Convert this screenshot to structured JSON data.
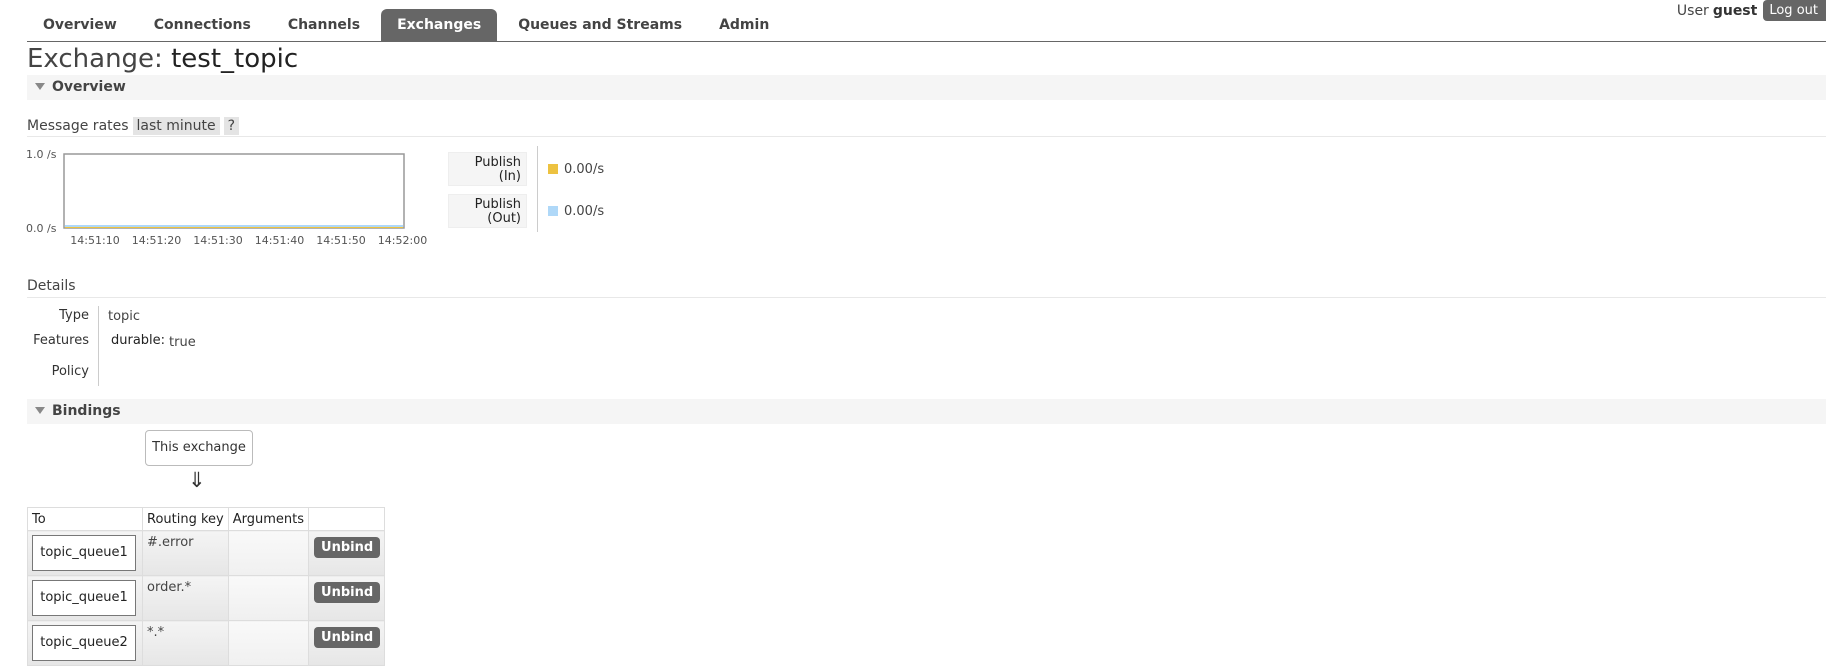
{
  "header": {
    "tabs": [
      {
        "label": "Overview"
      },
      {
        "label": "Connections"
      },
      {
        "label": "Channels"
      },
      {
        "label": "Exchanges",
        "selected": true
      },
      {
        "label": "Queues and Streams"
      },
      {
        "label": "Admin"
      }
    ],
    "user_label": "User",
    "user_name": "guest",
    "logout_label": "Log out"
  },
  "page": {
    "title_prefix": "Exchange:",
    "title_name": "test_topic"
  },
  "overview": {
    "section_label": "Overview",
    "rates_label": "Message rates",
    "range_label": "last minute",
    "help_label": "?",
    "chart_data": {
      "type": "line",
      "x": [
        "14:51:10",
        "14:51:20",
        "14:51:30",
        "14:51:40",
        "14:51:50",
        "14:52:00"
      ],
      "ylim": [
        0.0,
        1.0
      ],
      "ytick_labels": [
        "1.0 /s",
        "0.0 /s"
      ],
      "series": [
        {
          "name": "Publish (In)",
          "values": [
            0,
            0,
            0,
            0,
            0,
            0
          ],
          "color": "#edc240"
        },
        {
          "name": "Publish (Out)",
          "values": [
            0,
            0,
            0,
            0,
            0,
            0
          ],
          "color": "#afd8f8"
        }
      ]
    },
    "legend": [
      {
        "label_line1": "Publish",
        "label_line2": "(In)",
        "value": "0.00/s",
        "color": "#edc240"
      },
      {
        "label_line1": "Publish",
        "label_line2": "(Out)",
        "value": "0.00/s",
        "color": "#afd8f8"
      }
    ]
  },
  "details": {
    "title": "Details",
    "type_label": "Type",
    "type_value": "topic",
    "features_label": "Features",
    "durable_key": "durable:",
    "durable_value": "true",
    "policy_label": "Policy",
    "policy_value": ""
  },
  "bindings": {
    "section_label": "Bindings",
    "this_exchange_label": "This exchange",
    "arrow": "⇓",
    "columns": [
      "To",
      "Routing key",
      "Arguments",
      ""
    ],
    "rows": [
      {
        "to": "topic_queue1",
        "routing_key": "#.error",
        "arguments": "",
        "action": "Unbind"
      },
      {
        "to": "topic_queue1",
        "routing_key": "order.*",
        "arguments": "",
        "action": "Unbind"
      },
      {
        "to": "topic_queue2",
        "routing_key": "*.*",
        "arguments": "",
        "action": "Unbind"
      }
    ]
  }
}
